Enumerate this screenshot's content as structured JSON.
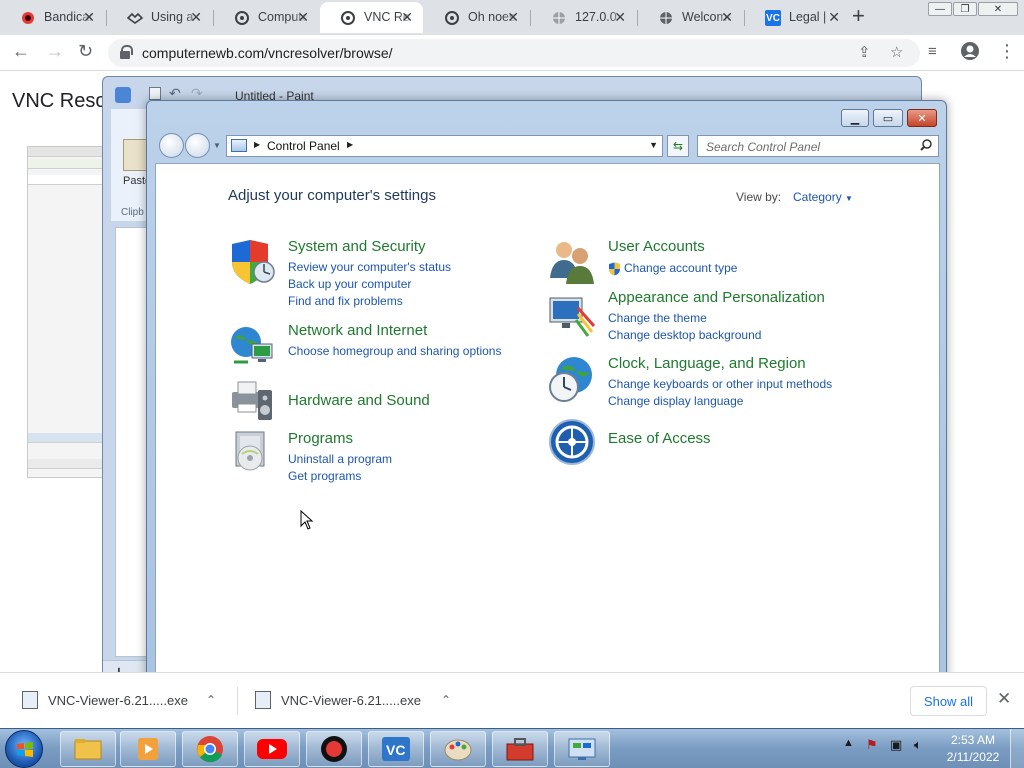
{
  "browser": {
    "tabs": [
      {
        "title": "Bandicam",
        "icon": "record-icon",
        "color": "#e53935"
      },
      {
        "title": "Using a",
        "icon": "handshake-icon",
        "color": "#3c4043"
      },
      {
        "title": "Computer",
        "icon": "vnc-logo-icon",
        "color": "#3c4043"
      },
      {
        "title": "VNC Re",
        "icon": "vnc-logo-icon",
        "color": "#3c4043"
      },
      {
        "title": "Oh noes",
        "icon": "vnc-logo-icon",
        "color": "#3c4043"
      },
      {
        "title": "127.0.0",
        "icon": "globe-icon",
        "color": "#5f6368"
      },
      {
        "title": "Welcome",
        "icon": "globe-icon",
        "color": "#5f6368"
      },
      {
        "title": "Legal |",
        "icon": "vc-logo-icon",
        "color": "#1a73e8"
      }
    ],
    "new_tab": "+",
    "url": "computernewb.com/vncresolver/browse/",
    "page_title": "VNC Resol"
  },
  "paint": {
    "title": "Untitled - Paint",
    "paste_label": "Paste",
    "clipboard_label": "Clipb"
  },
  "control_panel": {
    "breadcrumb": "Control Panel",
    "search_placeholder": "Search Control Panel",
    "heading": "Adjust your computer's settings",
    "view_by_label": "View by:",
    "view_by_value": "Category",
    "categories": [
      {
        "title": "System and Security",
        "links": [
          "Review your computer's status",
          "Back up your computer",
          "Find and fix problems"
        ]
      },
      {
        "title": "Network and Internet",
        "links": [
          "Choose homegroup and sharing options"
        ]
      },
      {
        "title": "Hardware and Sound",
        "links": []
      },
      {
        "title": "Programs",
        "links": [
          "Uninstall a program",
          "Get programs"
        ]
      },
      {
        "title": "User Accounts",
        "links": [
          "Change account type"
        ]
      },
      {
        "title": "Appearance and Personalization",
        "links": [
          "Change the theme",
          "Change desktop background"
        ]
      },
      {
        "title": "Clock, Language, and Region",
        "links": [
          "Change keyboards or other input methods",
          "Change display language"
        ]
      },
      {
        "title": "Ease of Access",
        "links": []
      }
    ]
  },
  "downloads": {
    "items": [
      {
        "name": "VNC-Viewer-6.21.....exe"
      },
      {
        "name": "VNC-Viewer-6.21.....exe"
      }
    ],
    "show_all": "Show all"
  },
  "taskbar": {
    "time": "2:53 AM",
    "date": "2/11/2022"
  },
  "colors": {
    "link": "#1e56b0",
    "category_title": "#1e7a2e",
    "heading": "#1e395b"
  }
}
